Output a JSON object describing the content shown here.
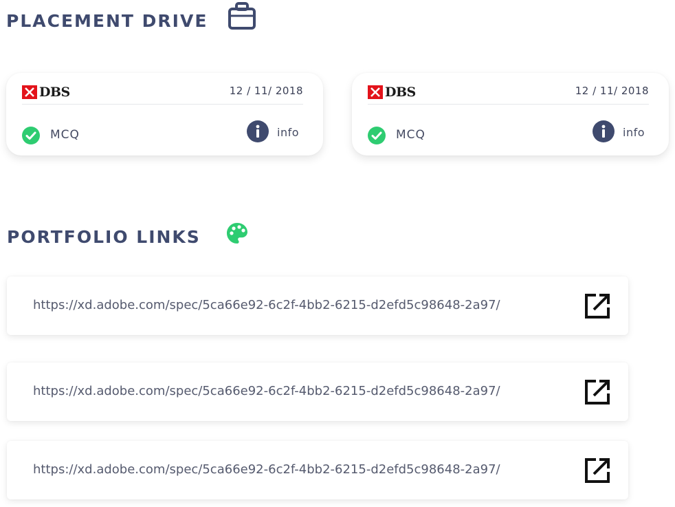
{
  "placement": {
    "title": "PLACEMENT DRIVE",
    "icon": "briefcase-icon",
    "cards": [
      {
        "logo_text": "DBS",
        "date": "12 / 11/ 2018",
        "type": "MCQ",
        "info_label": "info"
      },
      {
        "logo_text": "DBS",
        "date": "12 / 11/ 2018",
        "type": "MCQ",
        "info_label": "info"
      }
    ]
  },
  "portfolio": {
    "title": "PORTFOLIO LINKS",
    "icon": "palette-icon",
    "links": [
      {
        "url": "https://xd.adobe.com/spec/5ca66e92-6c2f-4bb2-6215-d2efd5c98648-2a97/"
      },
      {
        "url": "https://xd.adobe.com/spec/5ca66e92-6c2f-4bb2-6215-d2efd5c98648-2a97/"
      },
      {
        "url": "https://xd.adobe.com/spec/5ca66e92-6c2f-4bb2-6215-d2efd5c98648-2a97/"
      }
    ]
  },
  "colors": {
    "title": "#3f4a6e",
    "check_green": "#2ecc71",
    "palette_green": "#2ecc71",
    "info_dark": "#3f4a6e",
    "dbs_red": "#e3131b"
  }
}
